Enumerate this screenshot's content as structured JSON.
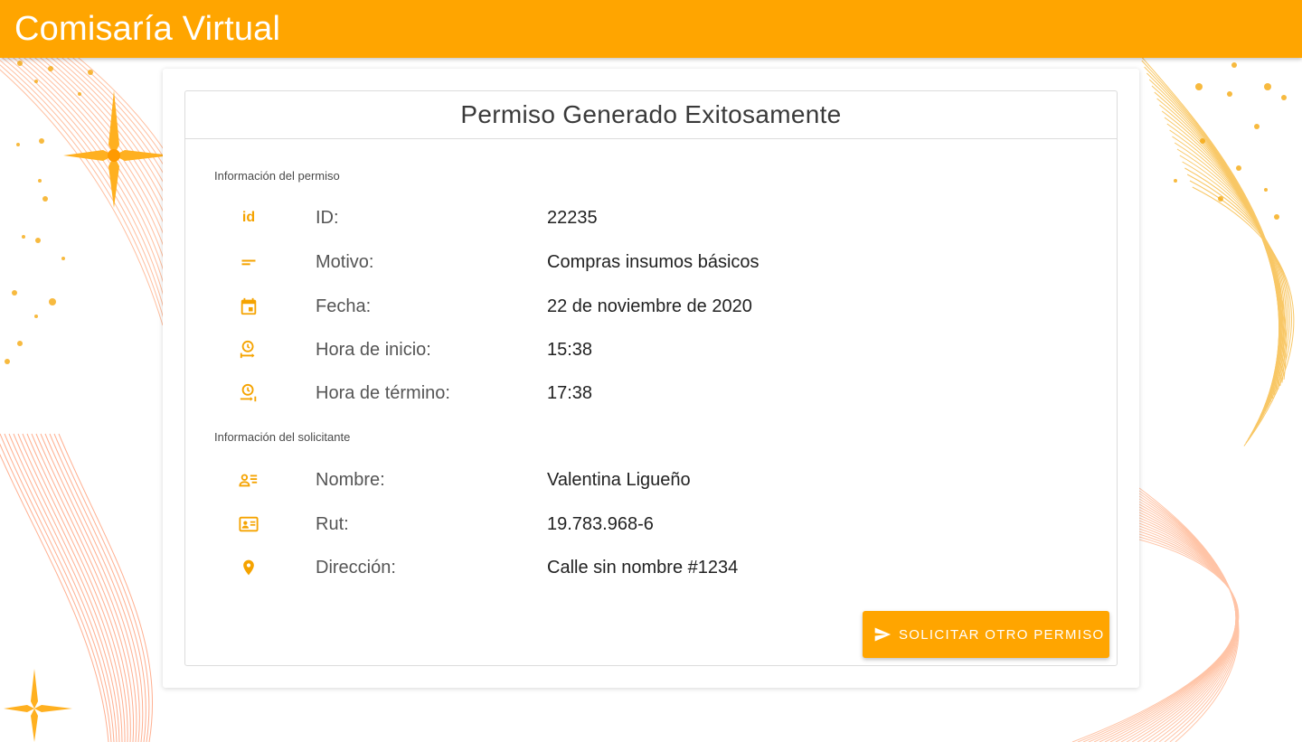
{
  "app": {
    "title": "Comisaría Virtual"
  },
  "card": {
    "title": "Permiso Generado Exitosamente"
  },
  "permit_section": {
    "heading": "Información del permiso",
    "rows": [
      {
        "icon": "id-icon",
        "label": "ID:",
        "value": "22235"
      },
      {
        "icon": "subject-icon",
        "label": "Motivo:",
        "value": "Compras insumos básicos"
      },
      {
        "icon": "calendar-icon",
        "label": "Fecha:",
        "value": "22 de noviembre de 2020"
      },
      {
        "icon": "clock-start-icon",
        "label": "Hora de inicio:",
        "value": "15:38"
      },
      {
        "icon": "clock-end-icon",
        "label": "Hora de término:",
        "value": "17:38"
      }
    ]
  },
  "applicant_section": {
    "heading": "Información del solicitante",
    "rows": [
      {
        "icon": "person-list-icon",
        "label": "Nombre:",
        "value": "Valentina Ligueño"
      },
      {
        "icon": "id-card-icon",
        "label": "Rut:",
        "value": "19.783.968-6"
      },
      {
        "icon": "location-pin-icon",
        "label": "Dirección:",
        "value": "Calle sin nombre #1234"
      }
    ]
  },
  "actions": {
    "request_again_label": "SOLICITAR OTRO PERMISO",
    "request_again_icon": "send-icon"
  },
  "colors": {
    "accent": "#ffa500",
    "icon": "#f5a300",
    "background_lines": "#ff8a50"
  }
}
